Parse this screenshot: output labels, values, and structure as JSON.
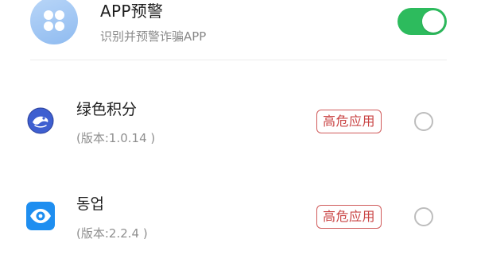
{
  "app_warning": {
    "icon": "app-grid-icon",
    "title": "APP预警",
    "subtitle": "识别并预警诈骗APP",
    "toggle_on": true,
    "toggle_color": "#2dbb5d"
  },
  "apps": [
    {
      "icon": "green-points-app-icon",
      "name": "绿色积分",
      "version": "(版本:1.0.14 )",
      "badge": "高危应用",
      "selected": false
    },
    {
      "icon": "dongye-app-icon",
      "name": "동업",
      "version": "(版本:2.2.4 )",
      "badge": "高危应用",
      "selected": false
    }
  ],
  "colors": {
    "badge": "#c94343",
    "accent_blue": "#2d8cf0",
    "icon_bg": "#8fbbf0"
  }
}
